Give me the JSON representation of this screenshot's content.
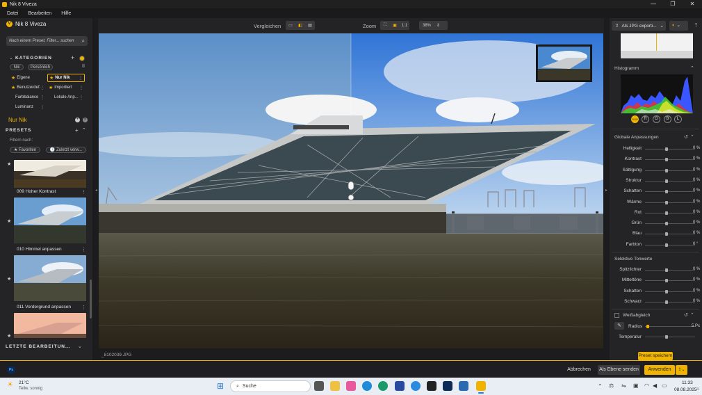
{
  "window": {
    "title": "Nik 8 Viveza",
    "controls": [
      "—",
      "❐",
      "✕"
    ]
  },
  "menu": [
    "Datei",
    "Bearbeiten",
    "Hilfe"
  ],
  "left": {
    "brand": "Nik 8 Viveza",
    "search_placeholder": "Nach einem Preset, Filter... suchen",
    "categories_title": "KATEGORIEN",
    "tabs": [
      "Nik",
      "Persönlich"
    ],
    "category_buttons": [
      "Eigene",
      "Nur Nik",
      "Benutzerdef.",
      "Importiert",
      "Farbbalance",
      "Lokale Anp...",
      "Luminanz"
    ],
    "active_filter": "Nur Nik",
    "presets_title": "PRESETS",
    "filter_label": "Filtern nach:",
    "filter_pills": [
      "Favoriten",
      "Zuletzt verw..."
    ],
    "presets": [
      "009 Hoher Kontrast",
      "010 Himmel anpassen",
      "011 Vordergrund anpassen"
    ],
    "recent_title": "LETZTE BEARBEITUN..."
  },
  "center": {
    "compare_label": "Vergleichen",
    "zoom_label": "Zoom",
    "zoom_one": "1:1",
    "zoom_value": "38%",
    "filename": "_8102039.JPG"
  },
  "right": {
    "export_label": "Als JPG exporti...",
    "histogram_title": "Histogramm",
    "channels": [
      "RGB",
      "R",
      "G",
      "B",
      "L"
    ],
    "global_title": "Globale Anpassungen",
    "global_rows": [
      {
        "label": "Helligkeit",
        "value": "0 %"
      },
      {
        "label": "Kontrast",
        "value": "0 %"
      },
      {
        "label": "Sättigung",
        "value": "0 %"
      },
      {
        "label": "Struktur",
        "value": "0 %"
      },
      {
        "label": "Schatten",
        "value": "0 %"
      },
      {
        "label": "Wärme",
        "value": "0 %"
      },
      {
        "label": "Rot",
        "value": "0 %"
      },
      {
        "label": "Grün",
        "value": "0 %"
      },
      {
        "label": "Blau",
        "value": "0 %"
      },
      {
        "label": "Farbton",
        "value": "0 °"
      }
    ],
    "selective_title": "Selektive Tonwerte",
    "selective_rows": [
      {
        "label": "Spitzlichter",
        "value": "0 %"
      },
      {
        "label": "Mitteltöne",
        "value": "0 %"
      },
      {
        "label": "Schatten",
        "value": "0 %"
      },
      {
        "label": "Schwarz",
        "value": "0 %"
      }
    ],
    "wb_title": "Weißabgleich",
    "radius_label": "Radius",
    "radius_value": "5 Px",
    "temp_label": "Temperatur",
    "save_preset": "Preset speichern"
  },
  "bottom": {
    "ps_badge": "Ps",
    "cancel": "Abbrechen",
    "as_layer": "Als Ebene senden",
    "apply": "Anwenden"
  },
  "taskbar": {
    "temp": "21°C",
    "weather": "Teilw. sonnig",
    "search": "Suche",
    "time": "11:33",
    "date": "08.08.2025"
  },
  "colors": {
    "accent": "#f0b400",
    "panel": "#242426",
    "bg": "#1c1c1e"
  }
}
